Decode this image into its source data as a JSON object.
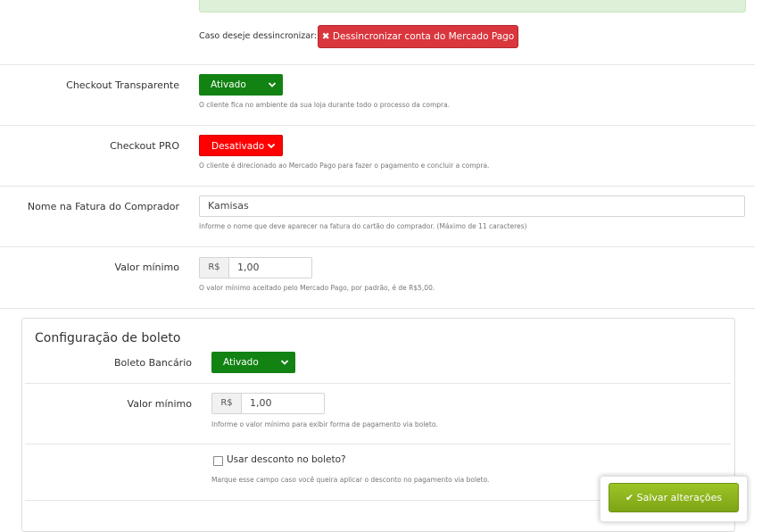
{
  "mercado_pago": {
    "unsync_label": "Caso deseje dessincronizar:",
    "unsync_button": "Dessincronizar conta do Mercado Pago"
  },
  "checkout_transparente": {
    "label": "Checkout Transparente",
    "value": "Ativado",
    "help": "O cliente fica no ambiente da sua loja durante todo o processo da compra."
  },
  "checkout_pro": {
    "label": "Checkout PRO",
    "value": "Desativado",
    "help": "O cliente é direcionado ao Mercado Pago para fazer o pagamento e concluir a compra."
  },
  "nome_fatura": {
    "label": "Nome na Fatura do Comprador",
    "value": "Kamisas",
    "help": "Informe o nome que deve aparecer na fatura do cartão do comprador. (Máximo de 11 caracteres)"
  },
  "valor_minimo": {
    "label": "Valor mínimo",
    "currency": "R$",
    "value": "1,00",
    "help": "O valor mínimo aceitado pelo Mercado Pago, por padrão, é de R$5,00."
  },
  "boleto": {
    "title": "Configuração de boleto",
    "bancario_label": "Boleto Bancário",
    "bancario_value": "Ativado",
    "valor_label": "Valor mínimo",
    "currency": "R$",
    "valor_value": "1,00",
    "valor_help": "Informe o valor mínimo para exibir forma de pagamento via boleto.",
    "desconto_label": "Usar desconto no boleto?",
    "desconto_help": "Marque esse campo caso você queira aplicar o desconto no pagamento via boleto."
  },
  "save_button": "Salvar alterações"
}
